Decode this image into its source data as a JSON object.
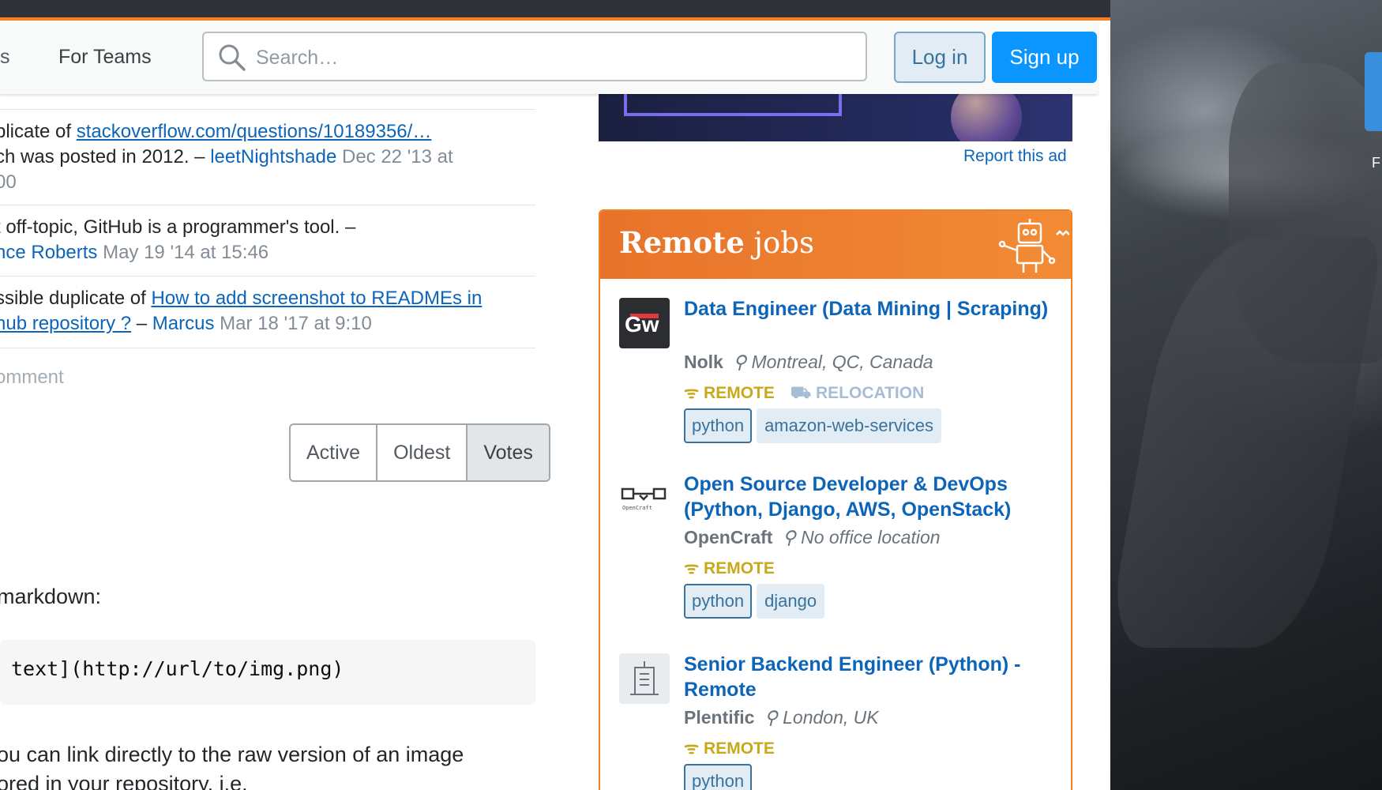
{
  "header": {
    "prev_nav_label": "s",
    "teams_label": "For Teams",
    "search_placeholder": "Search…",
    "login_label": "Log in",
    "signup_label": "Sign up"
  },
  "comments": [
    {
      "prefix": "plicate of ",
      "link": "stackoverflow.com/questions/10189356/…",
      "line2_text": "ch was posted in 2012. – ",
      "user": "leetNightshade",
      "date": "Dec 22 '13 at",
      "line3": "00"
    },
    {
      "line1": "t off-topic, GitHub is a programmer's tool. –",
      "user": "nce Roberts",
      "date": "May 19 '14 at 15:46"
    },
    {
      "prefix": "ssible duplicate of ",
      "link_line1": "How to add screenshot to READMEs in",
      "link_line2": "hub repository ?",
      "separator": " – ",
      "user": "Marcus",
      "date": "Mar 18 '17 at 9:10"
    }
  ],
  "add_comment": "omment",
  "sort_tabs": [
    "Active",
    "Oldest",
    "Votes"
  ],
  "answer": {
    "intro": "markdown:",
    "code": "text](http://url/to/img.png)",
    "para_line1": "ou can link directly to the raw version of an image",
    "para_line2": "ored in your repository, i.e."
  },
  "ad": {
    "report": "Report this ad"
  },
  "jobs": {
    "title_bold": "Remote",
    "title_rest": " jobs",
    "items": [
      {
        "logo_text": "Gw",
        "title": "Data Engineer (Data Mining | Scraping)",
        "company": "Nolk",
        "location": "Montreal, QC, Canada",
        "remote": "REMOTE",
        "relocation": "RELOCATION",
        "tags": [
          "python",
          "amazon-web-services"
        ]
      },
      {
        "logo_text": "OpenCraft",
        "title": "Open Source Developer & DevOps (Python, Django, AWS, OpenStack)",
        "company": "OpenCraft",
        "location": "No office location",
        "remote": "REMOTE",
        "tags": [
          "python",
          "django"
        ]
      },
      {
        "title": "Senior Backend Engineer (Python) - Remote",
        "company": "Plentific",
        "location": "London, UK",
        "remote": "REMOTE",
        "tags": [
          "python"
        ]
      }
    ]
  },
  "desktop": {
    "folder_label": "F"
  },
  "colors": {
    "accent": "#f48024",
    "link": "#0c65b8",
    "primary_button": "#0a95ff",
    "remote": "#c8a91b"
  }
}
